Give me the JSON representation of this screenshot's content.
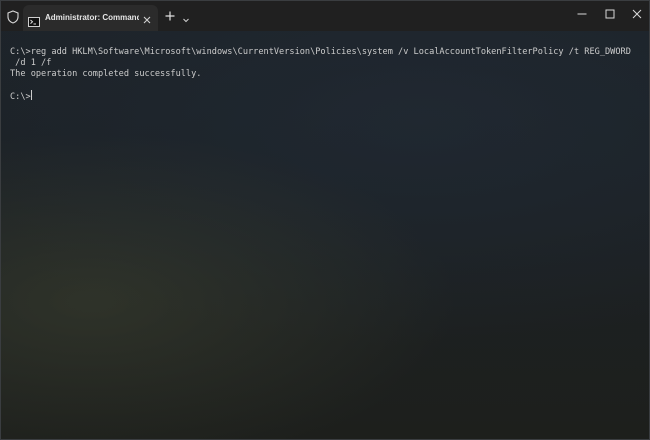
{
  "window": {
    "tab_title": "Administrator: Command Prompt"
  },
  "icons": {
    "shield": "shield-icon",
    "tab": "cmd-icon",
    "tab_close": "close-icon",
    "new_tab": "plus-icon",
    "dropdown": "chevron-down-icon",
    "minimize": "minimize-icon",
    "maximize": "maximize-icon",
    "close": "close-icon"
  },
  "terminal": {
    "command_line": "C:\\>reg add HKLM\\Software\\Microsoft\\windows\\CurrentVersion\\Policies\\system /v LocalAccountTokenFilterPolicy /t REG_DWORD",
    "command_wrap": " /d 1 /f",
    "output": "The operation completed successfully.",
    "prompt": "C:\\>"
  },
  "colors": {
    "titlebar": "#202020",
    "active_tab": "#2b2b2b",
    "text": "#cccccc"
  }
}
